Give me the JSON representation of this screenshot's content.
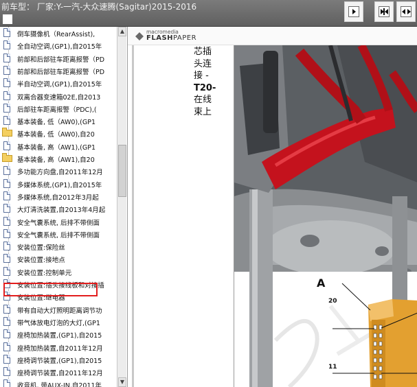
{
  "window": {
    "title": "前车型：  厂家:Y-一汽-大众速腾(Sagitar)2015-2016"
  },
  "toolbar": {
    "buttons": [
      {
        "name": "next-page-button",
        "icon": "play-right-icon"
      },
      {
        "name": "fit-width-button",
        "icon": "fit-width-icon"
      },
      {
        "name": "zoom-button",
        "icon": "expand-icon"
      }
    ]
  },
  "sidebar": {
    "items": [
      {
        "label": "倒车摄像机（RearAssist),",
        "icon": "document-icon"
      },
      {
        "label": "全自动空调,(GP1),自2015年",
        "icon": "document-icon"
      },
      {
        "label": "前部和后部驻车距离报警（PD",
        "icon": "document-icon"
      },
      {
        "label": "前部和后部驻车距离报警（PD",
        "icon": "document-icon"
      },
      {
        "label": "半自动空调,(GP1),自2015年",
        "icon": "document-icon"
      },
      {
        "label": "双离合器变速箱02E,自2013",
        "icon": "document-icon"
      },
      {
        "label": "后部驻车距离报警（PDC),(",
        "icon": "document-icon"
      },
      {
        "label": "基本装备, 低（AW0),(GP1",
        "icon": "document-icon"
      },
      {
        "label": "基本装备, 低（AW0),自20",
        "icon": "folder-icon"
      },
      {
        "label": "基本装备, 高（AW1),(GP1",
        "icon": "document-icon"
      },
      {
        "label": "基本装备, 高（AW1),自20",
        "icon": "folder-icon"
      },
      {
        "label": "多功能方向盘,自2011年12月",
        "icon": "document-icon"
      },
      {
        "label": "多媒体系统,(GP1),自2015年",
        "icon": "document-icon"
      },
      {
        "label": "多媒体系统,自2012年3月起",
        "icon": "document-icon"
      },
      {
        "label": "大灯清洗装置,自2013年4月起",
        "icon": "document-icon"
      },
      {
        "label": "安全气囊系统, 后排不带侧面",
        "icon": "document-icon"
      },
      {
        "label": "安全气囊系统, 后排不带侧面",
        "icon": "document-icon"
      },
      {
        "label": "安装位置:保险丝",
        "icon": "document-icon"
      },
      {
        "label": "安装位置:接地点",
        "icon": "document-icon"
      },
      {
        "label": "安装位置:控制单元",
        "icon": "document-icon",
        "selected": true
      },
      {
        "label": "安装位置:插头接线板和对接插",
        "icon": "document-icon"
      },
      {
        "label": "安装位置:继电器",
        "icon": "document-icon"
      },
      {
        "label": "带有自动大灯照明距离调节功",
        "icon": "document-icon"
      },
      {
        "label": "带气体放电灯泡的大灯,(GP1",
        "icon": "document-icon"
      },
      {
        "label": "座椅加热装置,(GP1),自2015",
        "icon": "document-icon"
      },
      {
        "label": "座椅加热装置,自2011年12月",
        "icon": "document-icon"
      },
      {
        "label": "座椅调节装置,(GP1),自2015",
        "icon": "document-icon"
      },
      {
        "label": "座椅调节装置,自2011年12月",
        "icon": "document-icon"
      },
      {
        "label": "收音机, 带AUX-IN,自2011年",
        "icon": "document-icon"
      }
    ]
  },
  "viewer": {
    "brand_top": "macromedia",
    "brand_bold": "FLASH",
    "brand_thin": "PAPER",
    "text_lines": [
      "芯插",
      "头连",
      "接 -",
      "T20-",
      "在线",
      "束上"
    ],
    "callout_label": "A",
    "pin_labels": [
      "20",
      "11"
    ]
  },
  "colors": {
    "highlight_border": "#e21d1d",
    "harness_red": "#c4121d",
    "connector_orange": "#e3a030",
    "title_bar": "#6e6e6e"
  }
}
